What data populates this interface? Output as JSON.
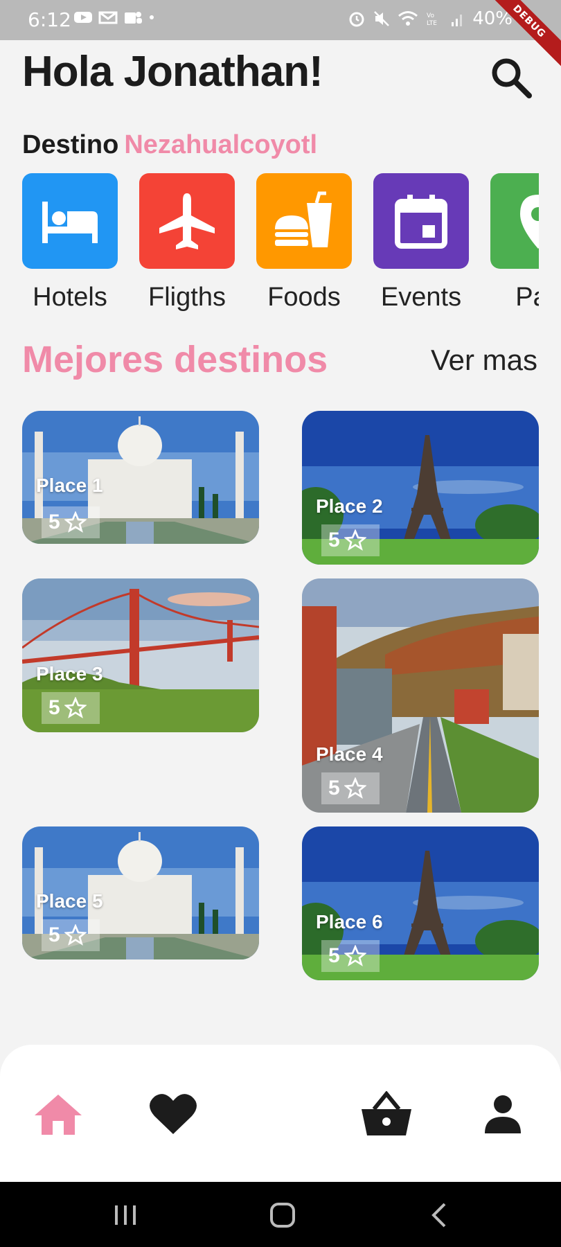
{
  "status_bar": {
    "time": "6:12",
    "battery": "40%",
    "left_icons": [
      "youtube-icon",
      "gmail-icon",
      "teams-icon",
      "dot-icon"
    ],
    "right_icons": [
      "alarm-icon",
      "mute-icon",
      "wifi-icon",
      "volte-icon",
      "signal-icon"
    ],
    "debug_label": "DEBUG"
  },
  "header": {
    "greeting": "Hola Jonathan!",
    "destino_label": "Destino",
    "destino_city": "Nezahualcoyotl"
  },
  "categories": [
    {
      "label": "Hotels",
      "icon": "bed-icon",
      "color": "#2196f3"
    },
    {
      "label": "Fligths",
      "icon": "airplane-icon",
      "color": "#f44336"
    },
    {
      "label": "Foods",
      "icon": "fastfood-icon",
      "color": "#ff9800"
    },
    {
      "label": "Events",
      "icon": "calendar-icon",
      "color": "#673ab7"
    },
    {
      "label": "Pac",
      "icon": "map-pin-icon",
      "color": "#4caf50"
    }
  ],
  "section": {
    "title": "Mejores destinos",
    "see_more": "Ver mas"
  },
  "places": [
    {
      "name": "Place 1",
      "rating": "5",
      "scene": "taj-mahal"
    },
    {
      "name": "Place 2",
      "rating": "5",
      "scene": "eiffel-tower"
    },
    {
      "name": "Place 3",
      "rating": "5",
      "scene": "golden-gate"
    },
    {
      "name": "Place 4",
      "rating": "5",
      "scene": "town-street"
    },
    {
      "name": "Place 5",
      "rating": "5",
      "scene": "taj-mahal"
    },
    {
      "name": "Place 6",
      "rating": "5",
      "scene": "eiffel-tower"
    }
  ],
  "bottom_nav": [
    {
      "name": "home",
      "icon": "home-icon",
      "active": true
    },
    {
      "name": "favorites",
      "icon": "heart-icon",
      "active": false
    },
    {
      "name": "cart",
      "icon": "basket-icon",
      "active": false
    },
    {
      "name": "profile",
      "icon": "person-icon",
      "active": false
    }
  ],
  "colors": {
    "accent": "#f08aa8",
    "background": "#f3f3f3",
    "text": "#1c1c1c"
  }
}
